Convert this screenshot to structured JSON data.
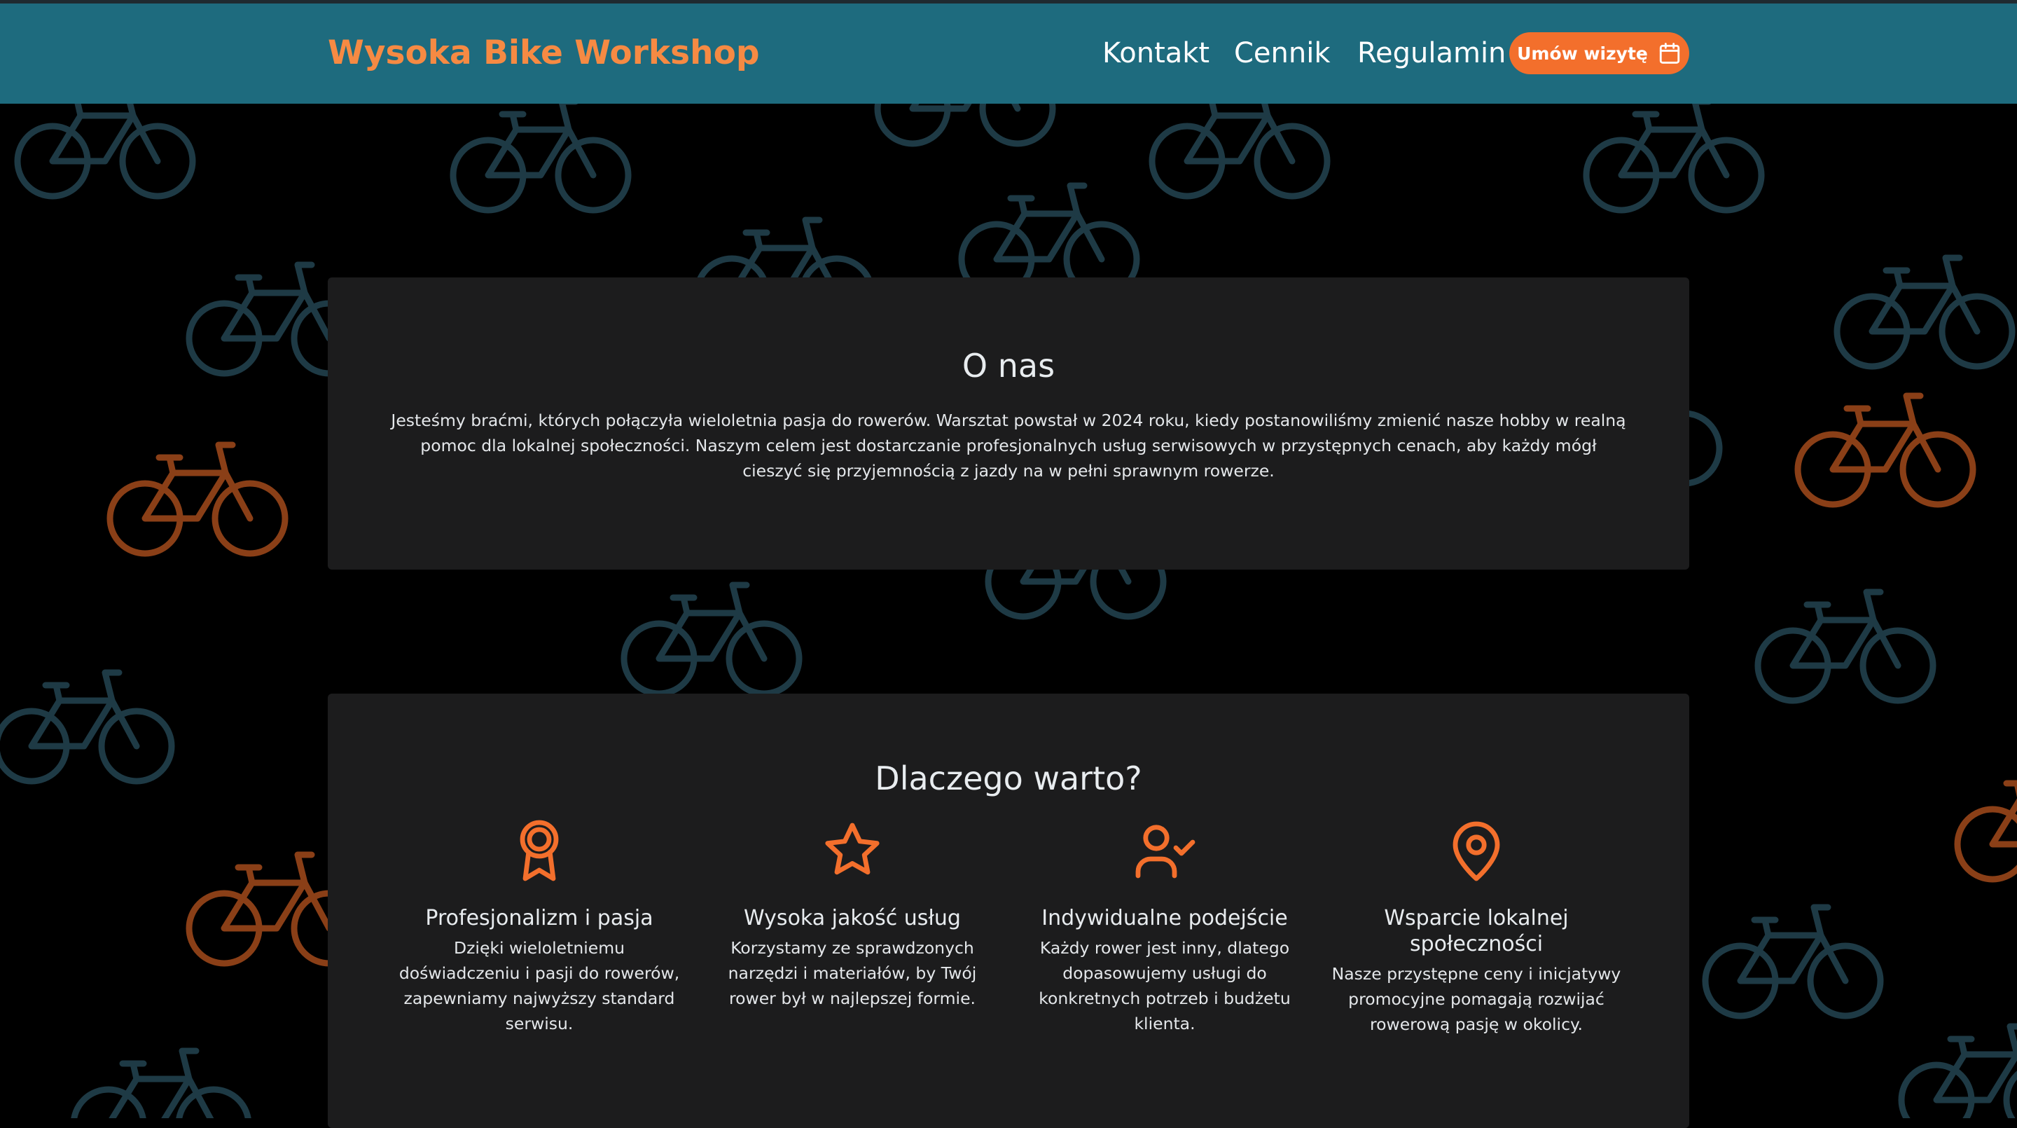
{
  "header": {
    "brand": "Wysoka Bike Workshop",
    "nav": [
      {
        "label": "Kontakt"
      },
      {
        "label": "Cennik"
      },
      {
        "label": "Regulamin"
      }
    ],
    "cta_label": "Umów wizytę",
    "cta_icon": "calendar-icon"
  },
  "about": {
    "title": "O nas",
    "text": "Jesteśmy braćmi, których połączyła wieloletnia pasja do rowerów. Warsztat powstał w 2024 roku, kiedy postanowiliśmy zmienić nasze hobby w realną pomoc dla lokalnej społeczności. Naszym celem jest dostarczanie profesjonalnych usług serwisowych w przystępnych cenach, aby każdy mógł cieszyć się przyjemnością z jazdy na w pełni sprawnym rowerze."
  },
  "why": {
    "title": "Dlaczego warto?",
    "features": [
      {
        "icon": "award-icon",
        "title": "Profesjonalizm i pasja",
        "text": "Dzięki wieloletniemu doświadczeniu i pasji do rowerów, zapewniamy najwyższy standard serwisu."
      },
      {
        "icon": "star-icon",
        "title": "Wysoka jakość usług",
        "text": "Korzystamy ze sprawdzonych narzędzi i materiałów, by Twój rower był w najlepszej formie."
      },
      {
        "icon": "user-check-icon",
        "title": "Indywidualne podejście",
        "text": "Każdy rower jest inny, dlatego dopasowujemy usługi do konkretnych potrzeb i budżetu klienta."
      },
      {
        "icon": "map-pin-icon",
        "title": "Wsparcie lokalnej społeczności",
        "text": "Nasze przystępne ceny i inicjatywy promocyjne pomagają rozwijać rowerową pasję w okolicy."
      }
    ]
  },
  "background": {
    "pattern_icon": "bicycle-icon",
    "colors": {
      "primary": "#1e3a45",
      "accent": "#8a3f17"
    }
  },
  "colors": {
    "header_bg": "#1e6b7e",
    "brand": "#f68a43",
    "accent": "#f36f2c",
    "card_bg": "#1c1c1d",
    "page_bg": "#000000"
  }
}
